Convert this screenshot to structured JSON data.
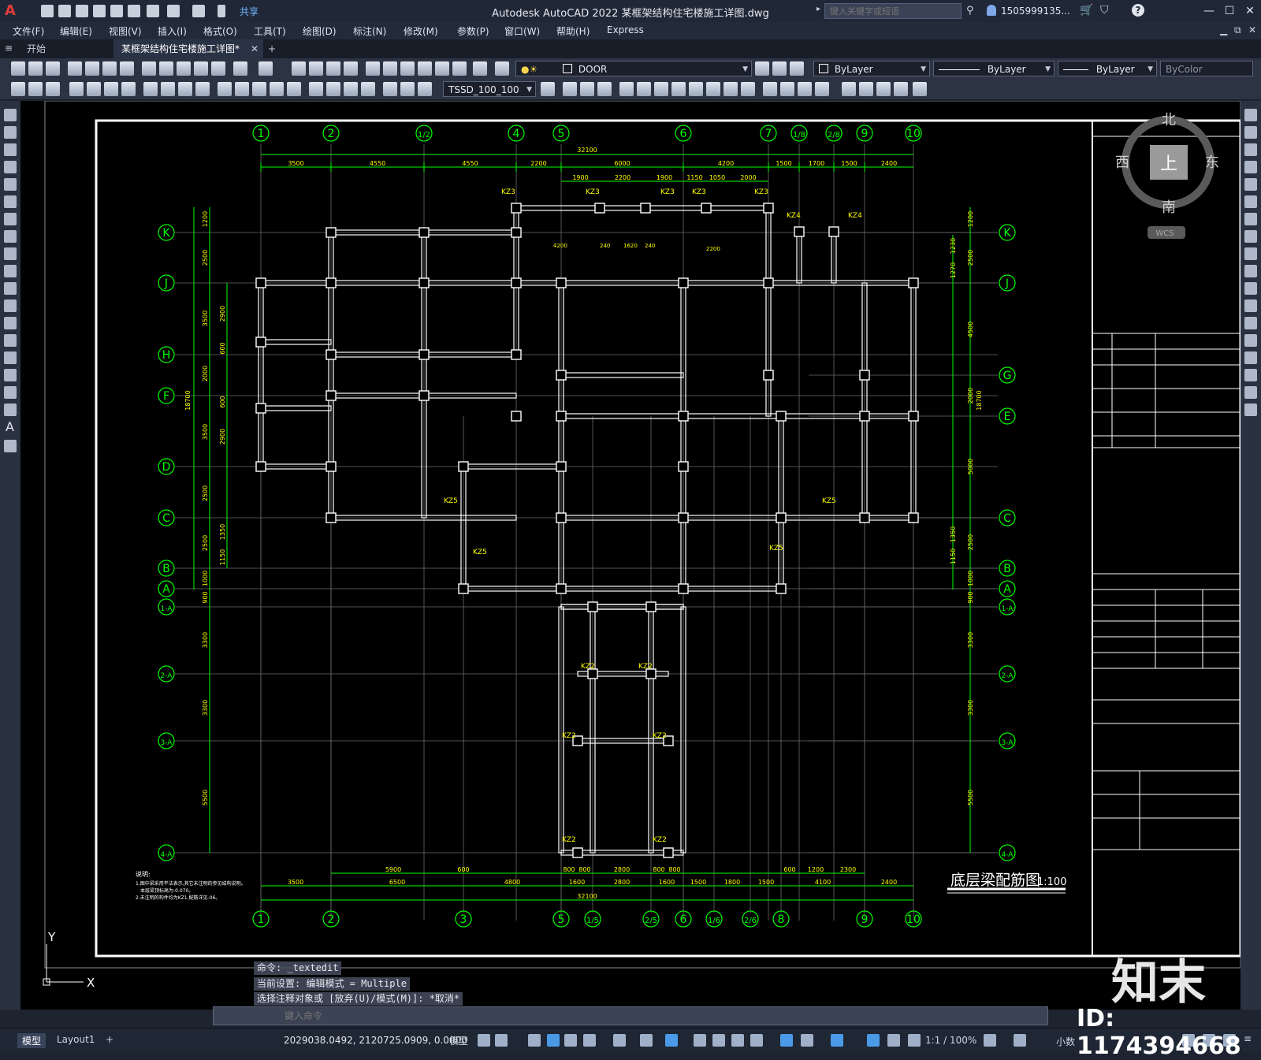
{
  "titlebar": {
    "logo": "A",
    "share": "共享",
    "title": "Autodesk AutoCAD 2022    某框架结构住宅楼施工详图.dwg",
    "search_placeholder": "键入关键字或短语",
    "user": "1505999135...",
    "min": "—",
    "max": "☐",
    "close": "✕"
  },
  "menus": [
    "文件(F)",
    "编辑(E)",
    "视图(V)",
    "插入(I)",
    "格式(O)",
    "工具(T)",
    "绘图(D)",
    "标注(N)",
    "修改(M)",
    "参数(P)",
    "窗口(W)",
    "帮助(H)",
    "Express"
  ],
  "tabs": {
    "start": "开始",
    "doc": "某框架结构住宅楼施工详图*",
    "close": "✕",
    "add": "+"
  },
  "ribbon": {
    "layer": "DOOR",
    "color": "ByLayer",
    "linetype": "ByLayer",
    "lineweight": "ByLayer",
    "plotstyle": "ByColor",
    "dimstyle": "TSSD_100_100"
  },
  "viewcube": {
    "north": "北",
    "south": "南",
    "west": "西",
    "east": "东",
    "top": "上",
    "wcs": "WCS"
  },
  "drawing": {
    "title": "底层梁配筋图",
    "scale": "1:100",
    "top_axes": [
      "1",
      "2",
      "1/2",
      "4",
      "5",
      "6",
      "7",
      "1/8",
      "2/8",
      "9",
      "10"
    ],
    "bottom_axes": [
      "1",
      "2",
      "3",
      "5",
      "1/5",
      "2/5",
      "6",
      "1/6",
      "2/6",
      "8",
      "9",
      "10"
    ],
    "left_axes": [
      "K",
      "J",
      "H",
      "F",
      "D",
      "C",
      "B",
      "A",
      "1-A",
      "2-A",
      "3-A",
      "4-A"
    ],
    "right_axes": [
      "K",
      "J",
      "G",
      "E",
      "C",
      "B",
      "A",
      "1-A",
      "2-A",
      "3-A",
      "4-A"
    ],
    "top_total": "32100",
    "top_dims_1": [
      "3500",
      "4550",
      "4550",
      "2200",
      "6000",
      "4200",
      "1500",
      "1700",
      "1500",
      "2400"
    ],
    "top_dims_2": [
      "1900",
      "2200",
      "1900",
      "1150",
      "1050",
      "2000"
    ],
    "bottom_dims_1": [
      "5900",
      "600",
      "800",
      "800",
      "2800",
      "800",
      "800",
      "600",
      "1200",
      "2300"
    ],
    "bottom_dims_2": [
      "3500",
      "6500",
      "4800",
      "1600",
      "2800",
      "1600",
      "1500",
      "1800",
      "1500",
      "4100",
      "2400"
    ],
    "bottom_total": "32100",
    "left_dims": [
      "1200",
      "2500",
      "3500",
      "2900",
      "600",
      "2000",
      "600",
      "3500",
      "2900",
      "2500",
      "2500",
      "1350",
      "1150",
      "1000",
      "900",
      "3300",
      "3300",
      "5500"
    ],
    "left_total": "18700",
    "right_total": "18700",
    "right_dims": [
      "1200",
      "1230",
      "2500",
      "1270",
      "4500",
      "2000",
      "5000",
      "1350",
      "2500",
      "1150",
      "1000",
      "900",
      "3300",
      "3300",
      "5500"
    ],
    "column_labels": [
      "KZ3",
      "KZ3",
      "KZ3",
      "KZ3",
      "KZ3",
      "KZ4",
      "KZ4",
      "KZ5",
      "KZ5",
      "KZ5",
      "KZ5",
      "KZ2",
      "KZ2",
      "KZ2",
      "KZ2",
      "KZ2",
      "KZ2"
    ],
    "inner_dims": [
      "4200",
      "240",
      "1620",
      "240",
      "2200"
    ],
    "notes_title": "说明:",
    "notes": [
      "1.图中梁采用平法表示,其它未注明的参见结构说明。",
      "本层梁顶标高为-0.070。",
      "2.未注明的构件均为KZ1,配筋详见-06。"
    ]
  },
  "command": {
    "line1": "命令: _textedit",
    "line2": "当前设置: 编辑模式 = Multiple",
    "line3": "选择注释对象或 [放弃(U)/模式(M)]: *取消*",
    "placeholder": "键入命令"
  },
  "ucs": {
    "y": "Y",
    "x": "X"
  },
  "status": {
    "model_tab": "模型",
    "layout_tab": "Layout1",
    "add": "+",
    "coords": "2029038.0492, 2120725.0909, 0.0000",
    "space": "模型",
    "anno_scale": "1:1 / 100%",
    "units": "小数"
  },
  "watermark": {
    "logo": "知末",
    "id": "ID: 1174394668"
  },
  "colors": {
    "grid": "#00ff00",
    "beam": "#ffffff",
    "label": "#ffff00",
    "bg": "#000000"
  }
}
